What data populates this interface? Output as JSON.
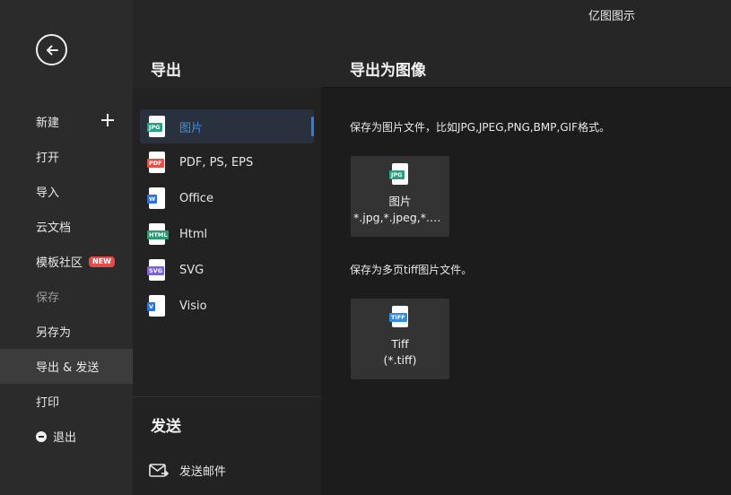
{
  "app_title": "亿图图示",
  "sidebar": {
    "items": [
      {
        "label": "新建",
        "name": "sidebar-item-new"
      },
      {
        "label": "打开",
        "name": "sidebar-item-open"
      },
      {
        "label": "导入",
        "name": "sidebar-item-import"
      },
      {
        "label": "云文档",
        "name": "sidebar-item-cloud"
      },
      {
        "label": "模板社区",
        "name": "sidebar-item-templates",
        "badge": "NEW"
      },
      {
        "label": "保存",
        "name": "sidebar-item-save",
        "disabled": true
      },
      {
        "label": "另存为",
        "name": "sidebar-item-save-as"
      },
      {
        "label": "导出 & 发送",
        "name": "sidebar-item-export-send",
        "active": true
      },
      {
        "label": "打印",
        "name": "sidebar-item-print"
      },
      {
        "label": "退出",
        "name": "sidebar-item-exit"
      }
    ]
  },
  "export_panel": {
    "title": "导出",
    "formats": [
      {
        "label": "图片",
        "icon": "jpg-file-icon",
        "tag": "JPG",
        "color": "#2e9e84",
        "active": true
      },
      {
        "label": "PDF, PS, EPS",
        "icon": "pdf-file-icon",
        "tag": "PDF",
        "color": "#e0534a"
      },
      {
        "label": "Office",
        "icon": "word-file-icon",
        "tag": "W",
        "color": "#2f6fd6"
      },
      {
        "label": "Html",
        "icon": "html-file-icon",
        "tag": "HTML",
        "color": "#2f9a72"
      },
      {
        "label": "SVG",
        "icon": "svg-file-icon",
        "tag": "SVG",
        "color": "#7b63d6"
      },
      {
        "label": "Visio",
        "icon": "visio-file-icon",
        "tag": "V",
        "color": "#2f6fd6"
      }
    ]
  },
  "send_panel": {
    "title": "发送",
    "mail_label": "发送邮件"
  },
  "detail": {
    "title": "导出为图像",
    "image_desc": "保存为图片文件，比如JPG,JPEG,PNG,BMP,GIF格式。",
    "image_card": {
      "label": "图片",
      "sub": "*.jpg,*.jpeg,*.png,*.bmp,*.gif",
      "tag": "JPG",
      "color": "#2e9e84"
    },
    "tiff_desc": "保存为多页tiff图片文件。",
    "tiff_card": {
      "label": "Tiff",
      "sub": "(*.tiff)",
      "tag": "TIFF",
      "color": "#2f8de0"
    }
  }
}
